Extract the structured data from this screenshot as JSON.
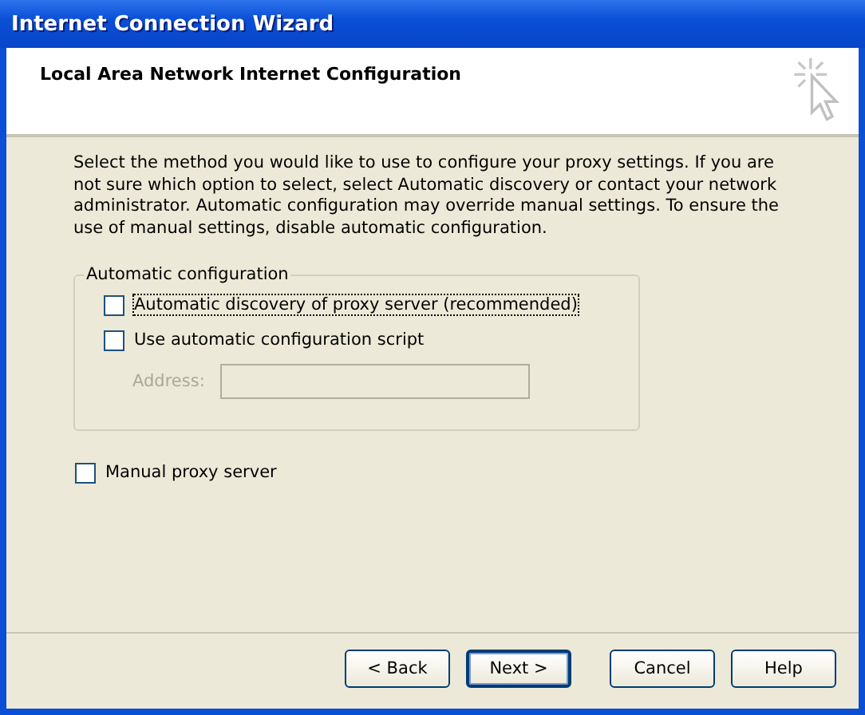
{
  "window": {
    "title": "Internet Connection Wizard"
  },
  "header": {
    "title": "Local Area Network Internet Configuration"
  },
  "description": "Select the method you would like to use to configure your proxy settings. If you are not sure which option to select, select Automatic discovery or contact your network administrator. Automatic configuration may override manual settings. To ensure the use of manual settings, disable automatic configuration.",
  "automatic_configuration": {
    "legend": "Automatic configuration",
    "options": [
      {
        "label": "Automatic discovery of proxy server (recommended)",
        "checked": false,
        "focused": true
      },
      {
        "label": "Use automatic configuration script",
        "checked": false,
        "focused": false
      }
    ],
    "address": {
      "label": "Address:",
      "disabled": true
    }
  },
  "manual_proxy": {
    "label": "Manual proxy server",
    "checked": false
  },
  "buttons": [
    {
      "label": "< Back",
      "default": false
    },
    {
      "label": "Next >",
      "default": true
    },
    {
      "label": "Cancel",
      "default": false
    },
    {
      "label": "Help",
      "default": false
    }
  ]
}
